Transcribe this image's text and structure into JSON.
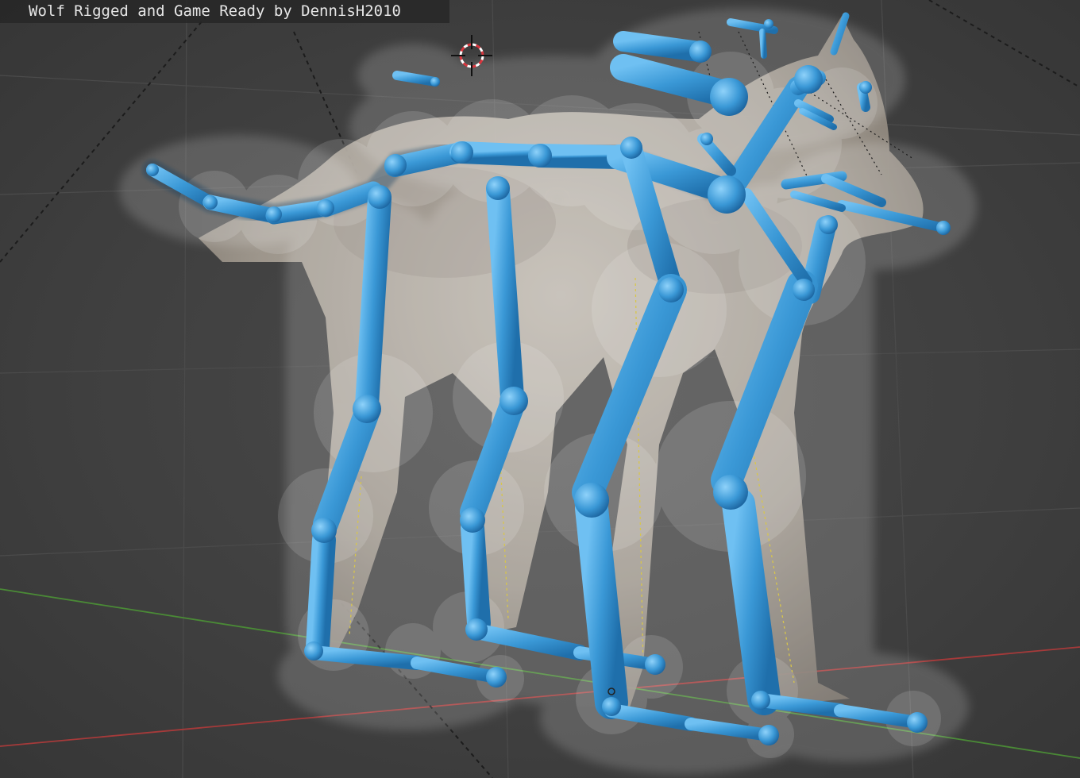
{
  "viewport": {
    "title": "Wolf Rigged and Game Ready by DennisH2010",
    "background": "#3e3e3e",
    "bone_color": "#3d9ad8",
    "envelope_color": "#ffffff",
    "axis_x_color": "#b03a3a",
    "axis_y_color": "#4f8a3a"
  },
  "objects": {
    "model": "wolf-mesh",
    "armature": "wolf-armature",
    "cursor": "3d-cursor-icon"
  }
}
